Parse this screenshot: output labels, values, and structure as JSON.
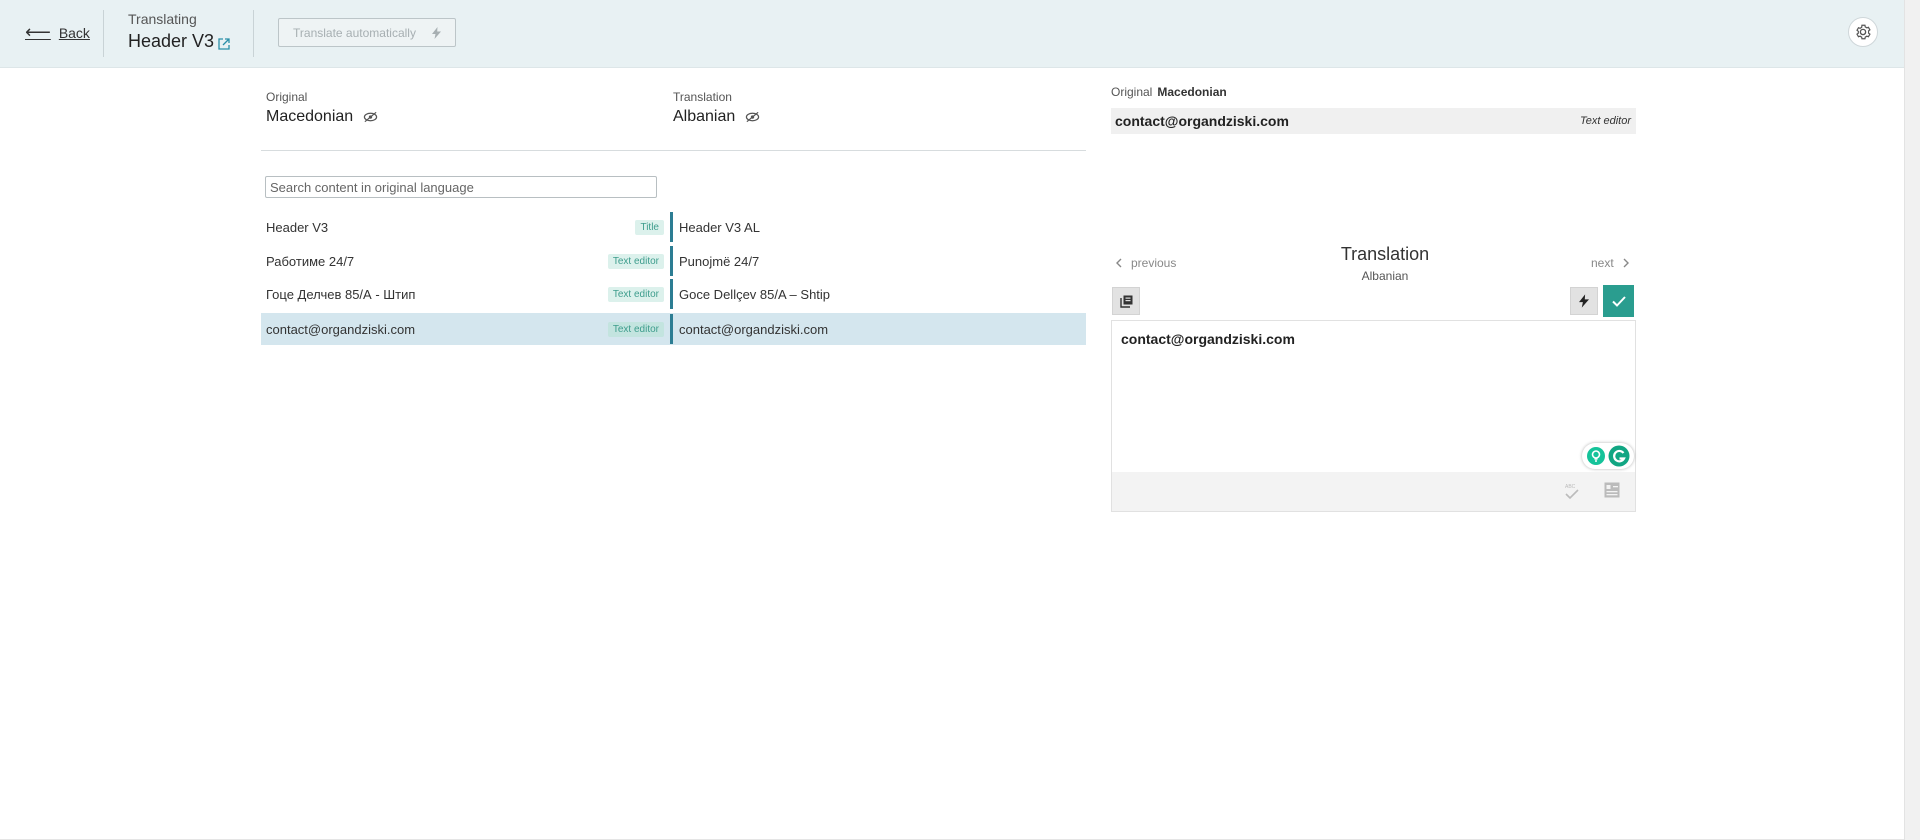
{
  "header": {
    "back_label": "Back",
    "crumb_small": "Translating",
    "crumb_title": "Header V3",
    "translate_auto_label": "Translate automatically"
  },
  "columns": {
    "original_label": "Original",
    "original_lang": "Macedonian",
    "translation_label": "Translation",
    "translation_lang": "Albanian"
  },
  "search": {
    "placeholder": "Search content in original language",
    "value": ""
  },
  "rows": [
    {
      "original": "Header V3",
      "tag": "Title",
      "translation": "Header V3 AL",
      "selected": false
    },
    {
      "original": "Работиме 24/7",
      "tag": "Text editor",
      "translation": "Punojmë 24/7",
      "selected": false
    },
    {
      "original": "Гоце Делчев 85/А - Штип",
      "tag": "Text editor",
      "translation": "Goce Dellçev 85/A – Shtip",
      "selected": false
    },
    {
      "original": "contact@organdziski.com",
      "tag": "Text editor",
      "translation": "contact@organdziski.com",
      "selected": true
    }
  ],
  "right_panel": {
    "orig_label": "Original",
    "orig_lang": "Macedonian",
    "orig_text": "contact@organdziski.com",
    "orig_tag": "Text editor",
    "prev_label": "previous",
    "next_label": "next",
    "title": "Translation",
    "subtitle": "Albanian",
    "editor_text": "contact@organdziski.com"
  },
  "colors": {
    "header_bg": "#e8f1f3",
    "accent": "#2a9d8f",
    "row_bar": "#2c7d93",
    "selected_row": "#d4e6ee",
    "tag_text": "#3e9d8d",
    "tag_bg": "#dcf1ec"
  },
  "icons": {
    "back": "arrow-left-icon",
    "external": "external-link-icon",
    "bolt": "lightning-icon",
    "gear": "gear-icon",
    "eye": "eye-slash-icon",
    "copy": "copy-icon",
    "check": "check-icon",
    "spell": "spellcheck-icon",
    "memory": "translation-memory-icon",
    "grammarly": "grammarly-icon"
  }
}
